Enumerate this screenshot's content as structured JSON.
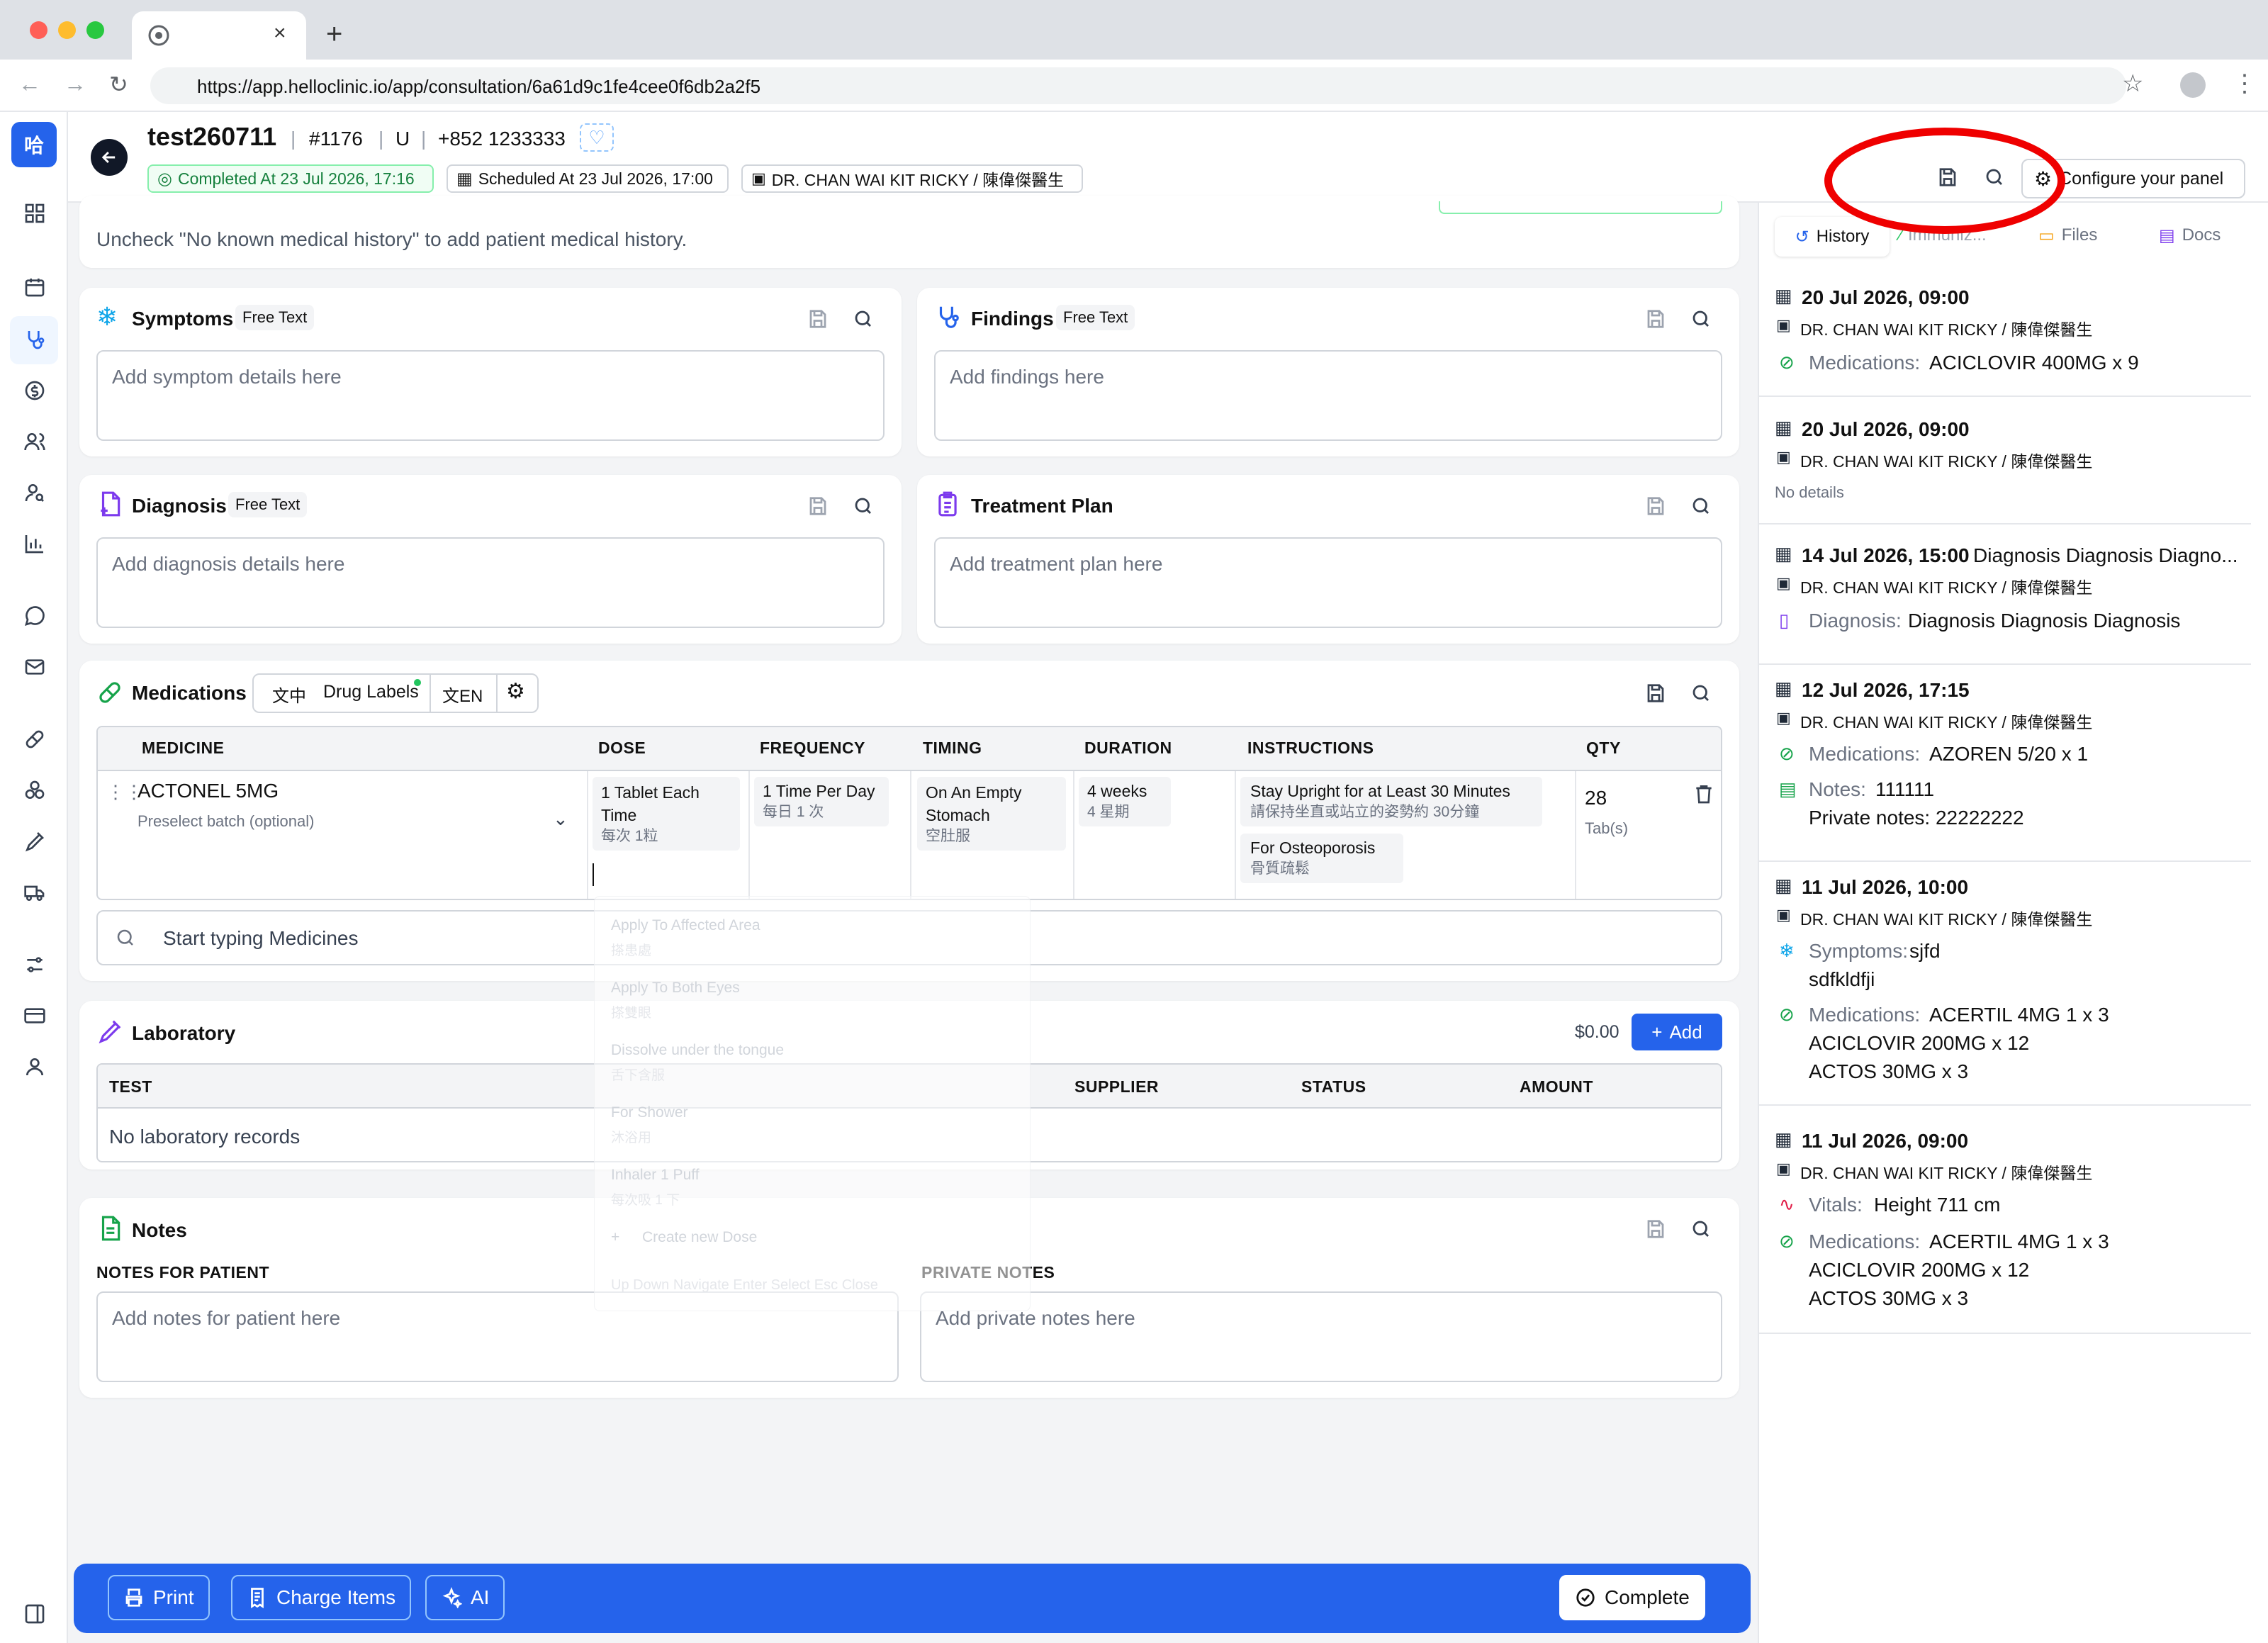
{
  "browser": {
    "url": "https://app.helloclinic.io/app/consultation/6a61d9c1fe4cee0f6db2a2f5"
  },
  "header": {
    "patient_name": "test260711",
    "patient_no": "#1176",
    "gender": "U",
    "phone": "+852 1233333",
    "completed": "Completed At  23 Jul 2026, 17:16",
    "scheduled": "Scheduled At  23 Jul 2026, 17:00",
    "doctor": "DR. CHAN WAI KIT RICKY / 陳偉傑醫生",
    "configure_label": "Configure your panel"
  },
  "medical_history": {
    "hint": "Uncheck \"No known medical history\" to add patient medical history."
  },
  "symptoms": {
    "title": "Symptoms",
    "tag": "Free Text",
    "placeholder": "Add symptom details here"
  },
  "findings": {
    "title": "Findings",
    "tag": "Free Text",
    "placeholder": "Add findings here"
  },
  "diagnosis": {
    "title": "Diagnosis",
    "tag": "Free Text",
    "placeholder": "Add diagnosis details here"
  },
  "treatment": {
    "title": "Treatment Plan",
    "placeholder": "Add treatment plan here"
  },
  "medications": {
    "title": "Medications",
    "lang_zh": "文中",
    "drug_labels": "Drug Labels",
    "lang_en": "文EN",
    "columns": [
      "MEDICINE",
      "DOSE",
      "FREQUENCY",
      "TIMING",
      "DURATION",
      "INSTRUCTIONS",
      "QTY"
    ],
    "row": {
      "medicine": "ACTONEL 5MG",
      "batch": "Preselect batch (optional)",
      "dose_en": "1 Tablet Each Time",
      "dose_zh": "每次 1粒",
      "freq_en": "1 Time Per Day",
      "freq_zh": "每日 1 次",
      "timing_en": "On An Empty Stomach",
      "timing_zh": "空肚服",
      "duration_en": "4 weeks",
      "duration_zh": "4 星期",
      "instr1_en": "Stay Upright for at Least 30 Minutes",
      "instr1_zh": "請保持坐直或站立的姿勢約 30分鐘",
      "instr2_en": "For Osteoporosis",
      "instr2_zh": "骨質疏鬆",
      "qty": "28",
      "unit": "Tab(s)"
    },
    "search_placeholder": "Start typing Medicines",
    "dropdown": [
      {
        "en": "Apply To Affected Area",
        "zh": "搽患處"
      },
      {
        "en": "Apply To Both Eyes",
        "zh": "搽雙眼"
      },
      {
        "en": "Dissolve under the tongue",
        "zh": "舌下含服"
      },
      {
        "en": "For Shower",
        "zh": "沐浴用"
      },
      {
        "en": "Inhaler 1 Puff",
        "zh": "每次吸 1 下"
      }
    ],
    "dropdown_create": "Create new Dose",
    "dropdown_keys": "Up   Down   Navigate   Enter   Select   Esc   Close"
  },
  "laboratory": {
    "title": "Laboratory",
    "total": "$0.00",
    "add_label": "Add",
    "columns": [
      "TEST",
      "SUPPLIER",
      "STATUS",
      "AMOUNT"
    ],
    "empty": "No laboratory records"
  },
  "notes": {
    "title": "Notes",
    "patient_label": "NOTES FOR PATIENT",
    "patient_placeholder": "Add notes for patient here",
    "private_label": "PRIVATE NOTES",
    "private_placeholder": "Add private notes here"
  },
  "bottom": {
    "print": "Print",
    "charge": "Charge Items",
    "ai": "AI",
    "complete": "Complete"
  },
  "right_panel": {
    "tabs": [
      "History",
      "Immuniz...",
      "Files",
      "Docs"
    ],
    "history": [
      {
        "date": "20 Jul 2026, 09:00",
        "doctor": "DR. CHAN WAI KIT RICKY / 陳偉傑醫生",
        "l1_label": "Medications:",
        "l1_value": "ACICLOVIR 400MG x 9"
      },
      {
        "date": "20 Jul 2026, 09:00",
        "doctor": "DR. CHAN WAI KIT RICKY / 陳偉傑醫生",
        "none": "No details"
      },
      {
        "date": "14 Jul 2026, 15:00",
        "extra": "Diagnosis Diagnosis Diagno...",
        "doctor": "DR. CHAN WAI KIT RICKY / 陳偉傑醫生",
        "l1_label": "Diagnosis:",
        "l1_value": "Diagnosis Diagnosis Diagnosis"
      },
      {
        "date": "12 Jul 2026, 17:15",
        "doctor": "DR. CHAN WAI KIT RICKY / 陳偉傑醫生",
        "l1_label": "Medications:",
        "l1_value": "AZOREN 5/20 x 1",
        "l2_label": "Notes:",
        "l2_value": "111111",
        "l2_extra": "Private notes: 22222222"
      },
      {
        "date": "11 Jul 2026, 10:00",
        "doctor": "DR. CHAN WAI KIT RICKY / 陳偉傑醫生",
        "l1_label": "Symptoms:",
        "l1_value": "sjfd",
        "l1_extra": "sdfkldfji",
        "l2_label": "Medications:",
        "l2_value": "ACERTIL 4MG 1 x 3",
        "l2_extra": "ACICLOVIR 200MG x 12",
        "l2_extra2": "ACTOS 30MG x 3"
      },
      {
        "date": "11 Jul 2026, 09:00",
        "doctor": "DR. CHAN WAI KIT RICKY / 陳偉傑醫生",
        "l1_label": "Vitals:",
        "l1_value": "Height 711 cm",
        "l2_label": "Medications:",
        "l2_value": "ACERTIL 4MG 1 x 3",
        "l2_extra": "ACICLOVIR 200MG x 12",
        "l2_extra2": "ACTOS 30MG x 3"
      }
    ]
  },
  "colors": {
    "accent": "#2563eb",
    "success": "#16a34a",
    "annotation": "#ef0000"
  }
}
